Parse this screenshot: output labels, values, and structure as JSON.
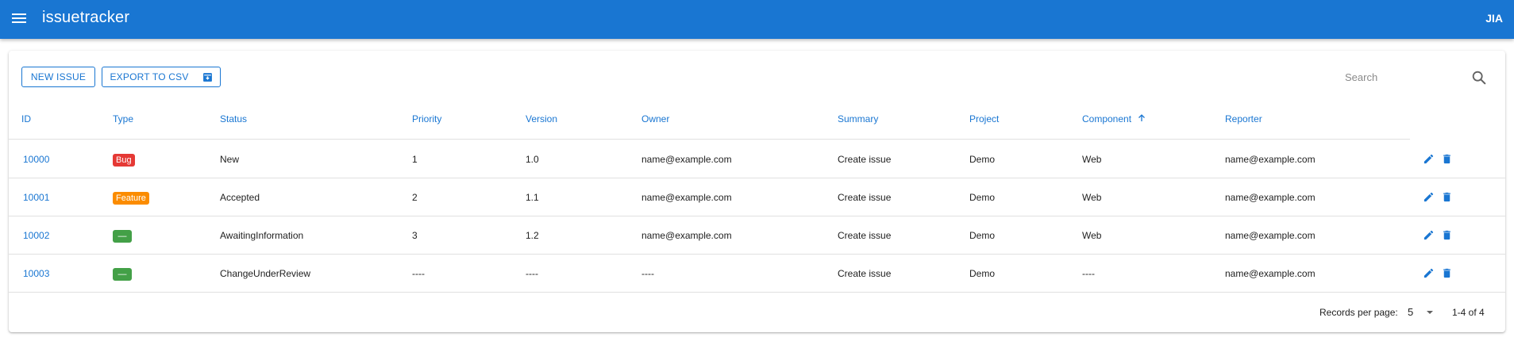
{
  "app": {
    "title": "issuetracker",
    "user_initials": "JIA",
    "brand_color": "#1976d2"
  },
  "toolbar": {
    "new_issue_label": "NEW ISSUE",
    "export_label": "EXPORT TO CSV",
    "search_placeholder": "Search",
    "search_value": ""
  },
  "table": {
    "columns": [
      "ID",
      "Type",
      "Status",
      "Priority",
      "Version",
      "Owner",
      "Summary",
      "Project",
      "Component",
      "Reporter"
    ],
    "sorted_column": "Component",
    "sort_direction": "ascending",
    "rows": [
      {
        "id": "10000",
        "type": "Bug",
        "type_color": "#e53935",
        "status": "New",
        "priority": "1",
        "version": "1.0",
        "owner": "name@example.com",
        "summary": "Create issue",
        "project": "Demo",
        "component": "Web",
        "reporter": "name@example.com"
      },
      {
        "id": "10001",
        "type": "Feature",
        "type_color": "#fb8c00",
        "status": "Accepted",
        "priority": "2",
        "version": "1.1",
        "owner": "name@example.com",
        "summary": "Create issue",
        "project": "Demo",
        "component": "Web",
        "reporter": "name@example.com"
      },
      {
        "id": "10002",
        "type": "—",
        "type_color": "#43a047",
        "status": "AwaitingInformation",
        "priority": "3",
        "version": "1.2",
        "owner": "name@example.com",
        "summary": "Create issue",
        "project": "Demo",
        "component": "Web",
        "reporter": "name@example.com"
      },
      {
        "id": "10003",
        "type": "—",
        "type_color": "#43a047",
        "status": "ChangeUnderReview",
        "priority": "----",
        "version": "----",
        "owner": "----",
        "summary": "Create issue",
        "project": "Demo",
        "component": "----",
        "reporter": "name@example.com"
      }
    ],
    "row_action_icons": [
      "edit-icon",
      "delete-icon"
    ]
  },
  "pagination": {
    "records_per_page_label": "Records per page:",
    "records_per_page": "5",
    "range_text": "1-4 of 4"
  }
}
